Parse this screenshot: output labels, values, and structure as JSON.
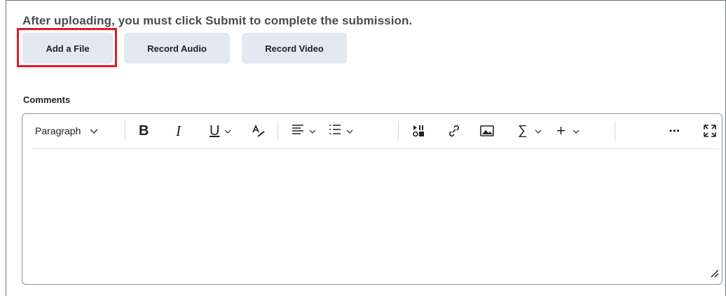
{
  "instruction": "After uploading, you must click Submit to complete the submission.",
  "buttons": {
    "add_file": "Add a File",
    "record_audio": "Record Audio",
    "record_video": "Record Video"
  },
  "comments": {
    "label": "Comments",
    "toolbar": {
      "format_select": "Paragraph",
      "bold": "B",
      "italic": "I",
      "underline": "U",
      "more": "•••"
    }
  },
  "colors": {
    "button_bg": "#e3e9f1",
    "highlight": "#e01b24",
    "border": "#8d9196"
  },
  "icons": [
    "chevron-down-icon",
    "bold-icon",
    "italic-icon",
    "underline-icon",
    "text-style-icon",
    "align-icon",
    "list-icon",
    "media-icon",
    "link-icon",
    "image-icon",
    "equation-icon",
    "insert-icon",
    "more-icon",
    "fullscreen-icon",
    "resize-handle-icon"
  ]
}
